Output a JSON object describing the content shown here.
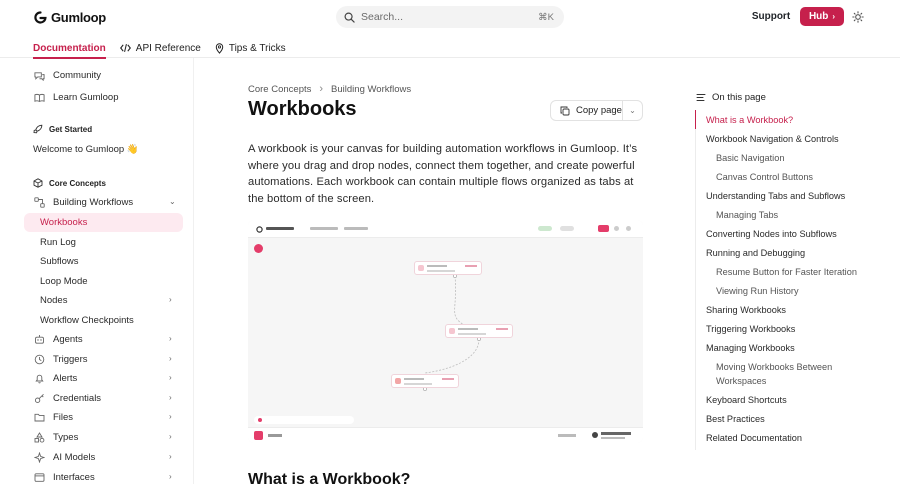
{
  "header": {
    "logo_text": "Gumloop",
    "search_placeholder": "Search...",
    "search_shortcut": "⌘K",
    "support_label": "Support",
    "hub_label": "Hub",
    "tabs": [
      {
        "label": "Documentation",
        "icon": "none"
      },
      {
        "label": "API Reference",
        "icon": "code-icon"
      },
      {
        "label": "Tips & Tricks",
        "icon": "map-pin-icon"
      }
    ],
    "accent_color": "#c6204c"
  },
  "sidebar": {
    "top_links": [
      {
        "label": "Community",
        "icon": "chat-icon"
      },
      {
        "label": "Learn Gumloop",
        "icon": "book-icon"
      }
    ],
    "get_started": {
      "heading": "Get Started",
      "items": [
        "Welcome to Gumloop 👋"
      ]
    },
    "core_concepts": {
      "heading": "Core Concepts",
      "group_label": "Building Workflows",
      "group_items": [
        "Workbooks",
        "Run Log",
        "Subflows",
        "Loop Mode",
        "Nodes",
        "Workflow Checkpoints"
      ],
      "other_groups": [
        "Agents",
        "Triggers",
        "Alerts",
        "Credentials",
        "Files",
        "Types",
        "AI Models",
        "Interfaces"
      ]
    }
  },
  "main": {
    "breadcrumbs": [
      "Core Concepts",
      "Building Workflows"
    ],
    "title": "Workbooks",
    "copy_label": "Copy page",
    "intro": "A workbook is your canvas for building automation workflows in Gumloop. It’s where you drag and drop nodes, connect them together, and create powerful automations. Each workbook can contain multiple flows organized as tabs at the bottom of the screen.",
    "section_heading": "What is a Workbook?"
  },
  "toc": {
    "heading": "On this page",
    "items": [
      {
        "label": "What is a Workbook?",
        "level": 1,
        "active": true
      },
      {
        "label": "Workbook Navigation & Controls",
        "level": 1
      },
      {
        "label": "Basic Navigation",
        "level": 2
      },
      {
        "label": "Canvas Control Buttons",
        "level": 2
      },
      {
        "label": "Understanding Tabs and Subflows",
        "level": 1
      },
      {
        "label": "Managing Tabs",
        "level": 2
      },
      {
        "label": "Converting Nodes into Subflows",
        "level": 1
      },
      {
        "label": "Running and Debugging",
        "level": 1
      },
      {
        "label": "Resume Button for Faster Iteration",
        "level": 2
      },
      {
        "label": "Viewing Run History",
        "level": 2
      },
      {
        "label": "Sharing Workbooks",
        "level": 1
      },
      {
        "label": "Triggering Workbooks",
        "level": 1
      },
      {
        "label": "Managing Workbooks",
        "level": 1
      },
      {
        "label": "Moving Workbooks Between",
        "level": 2
      },
      {
        "label": "Workspaces",
        "level": 2
      },
      {
        "label": "Keyboard Shortcuts",
        "level": 1
      },
      {
        "label": "Best Practices",
        "level": 1
      },
      {
        "label": "Related Documentation",
        "level": 1
      }
    ]
  }
}
